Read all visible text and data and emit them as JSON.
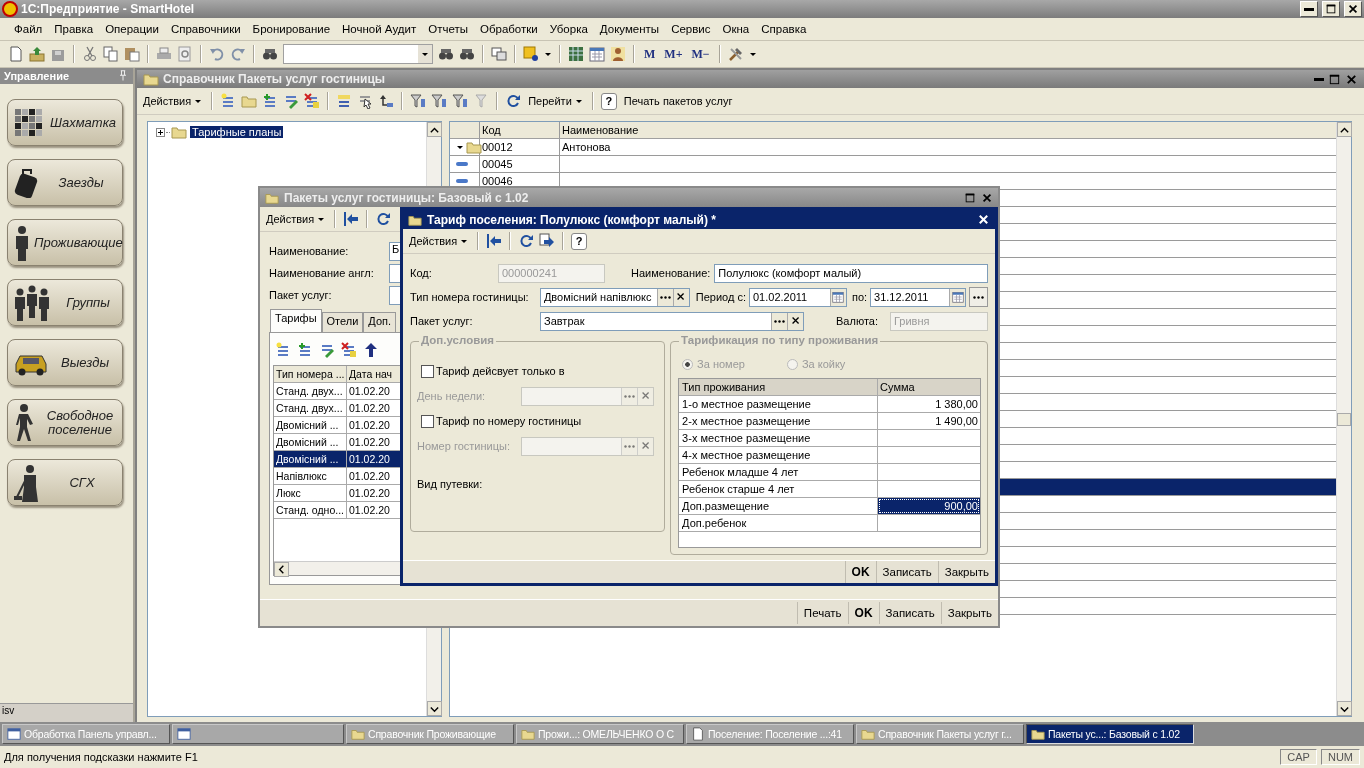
{
  "app": {
    "title": "1С:Предприятие - SmartHotel"
  },
  "menu": [
    {
      "label": "Файл"
    },
    {
      "label": "Правка"
    },
    {
      "label": "Операции"
    },
    {
      "label": "Справочники"
    },
    {
      "label": "Бронирование"
    },
    {
      "label": "Ночной Аудит"
    },
    {
      "label": "Отчеты"
    },
    {
      "label": "Обработки"
    },
    {
      "label": "Уборка"
    },
    {
      "label": "Документы"
    },
    {
      "label": "Сервис"
    },
    {
      "label": "Окна"
    },
    {
      "label": "Справка"
    }
  ],
  "toolbar": {
    "memory_buttons": [
      "M",
      "M+",
      "M−"
    ]
  },
  "sidebar": {
    "title": "Управление",
    "footer": "isv",
    "items": [
      {
        "label": "Шахматка",
        "kind": "grid"
      },
      {
        "label": "Заезды",
        "kind": "luggage"
      },
      {
        "label": "Проживающие",
        "kind": "person"
      },
      {
        "label": "Группы",
        "kind": "group"
      },
      {
        "label": "Выезды",
        "kind": "car"
      },
      {
        "label": "Свободное поселение",
        "kind": "walker"
      },
      {
        "label": "СГХ",
        "kind": "cleaner"
      }
    ]
  },
  "catalog_window": {
    "title": "Справочник Пакеты услуг гостиницы",
    "actions": "Действия",
    "goto": "Перейти",
    "help": "?",
    "print": "Печать пакетов услуг",
    "tree": [
      {
        "label": "Тарифные планы",
        "selected": true,
        "expanded": false
      }
    ],
    "columns": [
      "Код",
      "Наименование"
    ],
    "rows": [
      {
        "kind": "folder",
        "code": "00012",
        "name": "Антонова",
        "selected": false
      },
      {
        "kind": "item",
        "code": "00045",
        "selected": false
      },
      {
        "kind": "item",
        "code": "00046",
        "selected": false
      },
      {
        "selected": false
      },
      {
        "selected": false
      },
      {
        "selected": false
      },
      {
        "selected": false
      },
      {
        "selected": false
      },
      {
        "selected": false
      },
      {
        "selected": false
      },
      {
        "selected": false
      },
      {
        "selected": false
      },
      {
        "selected": false
      },
      {
        "selected": false
      },
      {
        "selected": false
      },
      {
        "selected": false
      },
      {
        "selected": false
      },
      {
        "selected": false
      },
      {
        "selected": false
      },
      {
        "selected": false
      },
      {
        "selected": true
      },
      {
        "selected": false
      },
      {
        "selected": false
      },
      {
        "selected": false
      },
      {
        "selected": false
      },
      {
        "selected": false
      },
      {
        "selected": false
      },
      {
        "selected": false
      }
    ]
  },
  "package_window": {
    "title": "Пакеты услуг гостиницы: Базовый с 1.02",
    "actions": "Действия",
    "fields": [
      {
        "label": "Наименование:",
        "value": "Б"
      },
      {
        "label": "Наименование англ:"
      },
      {
        "label": "Пакет услуг:"
      }
    ],
    "tabs": [
      {
        "label": "Тарифы",
        "selected": true
      },
      {
        "label": "Отели",
        "selected": false
      },
      {
        "label": "Доп.",
        "selected": false
      }
    ],
    "columns": [
      "Тип номера ...",
      "Дата нач"
    ],
    "rows": [
      {
        "type": "Станд. двух...",
        "date": "01.02.20",
        "selected": false
      },
      {
        "type": "Станд. двух...",
        "date": "01.02.20",
        "selected": false
      },
      {
        "type": "Двомісний ...",
        "date": "01.02.20",
        "selected": false
      },
      {
        "type": "Двомісний ...",
        "date": "01.02.20",
        "selected": false
      },
      {
        "type": "Двомісний ...",
        "date": "01.02.20",
        "selected": true
      },
      {
        "type": "Напівлюкс",
        "date": "01.02.20",
        "selected": false
      },
      {
        "type": "Люкс",
        "date": "01.02.20",
        "selected": false
      },
      {
        "type": "Станд. одно...",
        "date": "01.02.20",
        "selected": false
      }
    ],
    "buttons": [
      {
        "label": "Печать",
        "default": false
      },
      {
        "label": "OK",
        "default": true
      },
      {
        "label": "Записать",
        "default": false
      },
      {
        "label": "Закрыть",
        "default": false
      }
    ]
  },
  "tariff_window": {
    "title": "Тариф поселения: Полулюкс (комфорт малый) *",
    "actions": "Действия",
    "help": "?",
    "code": {
      "label": "Код:",
      "value": "000000241"
    },
    "name": {
      "label": "Наименование:",
      "value": "Полулюкс (комфорт малый)"
    },
    "room_type": {
      "label": "Тип номера гостиницы:",
      "value": "Двомісний напівлюкс"
    },
    "period_from": {
      "label": "Период с:",
      "value": "01.02.2011"
    },
    "period_to": {
      "label": "по:",
      "value": "31.12.2011"
    },
    "package": {
      "label": "Пакет услуг:",
      "value": "Завтрак"
    },
    "currency": {
      "label": "Валюта:",
      "value": "Гривня"
    },
    "conditions": {
      "title": "Доп.условия",
      "weekday_only": {
        "label": "Тариф дейсвует только в",
        "checked": false
      },
      "weekday": {
        "label": "День недели:"
      },
      "by_room": {
        "label": "Тариф по номеру гостиницы",
        "checked": false
      },
      "room": {
        "label": "Номер гостиницы:"
      },
      "voucher": {
        "label": "Вид путевки:"
      }
    },
    "pricing": {
      "title": "Тарификация по типу проживания",
      "modes": [
        {
          "label": "За номер",
          "selected": true
        },
        {
          "label": "За койку",
          "selected": false
        }
      ],
      "columns": [
        "Тип проживания",
        "Сумма"
      ],
      "rows": [
        {
          "type": "1-о местное размещение",
          "sum": "1 380,00",
          "selected": false
        },
        {
          "type": "2-х местное размещение",
          "sum": "1 490,00",
          "selected": false
        },
        {
          "type": "3-х местное размещение",
          "selected": false
        },
        {
          "type": "4-х местное размещение",
          "selected": false
        },
        {
          "type": "Ребенок младше 4 лет",
          "selected": false
        },
        {
          "type": "Ребенок старше 4 лет",
          "selected": false
        },
        {
          "type": "Доп.размещение",
          "sum": "900,00",
          "selected": true
        },
        {
          "type": "Доп.ребенок",
          "selected": false
        }
      ]
    },
    "buttons": [
      {
        "label": "OK",
        "default": true
      },
      {
        "label": "Записать",
        "default": false
      },
      {
        "label": "Закрыть",
        "default": false
      }
    ]
  },
  "taskbar": [
    {
      "kind": "form",
      "label": "Обработка  Панель управл...",
      "selected": false
    },
    {
      "kind": "form",
      "selected": false
    },
    {
      "kind": "folder",
      "label": "Справочник Проживающие",
      "selected": false
    },
    {
      "kind": "folder",
      "label": "Прожи...: ОМЕЛЬЧЕНКО О С",
      "selected": false
    },
    {
      "kind": "doc",
      "label": "Поселение: Поселение ...:41",
      "selected": false
    },
    {
      "kind": "folder",
      "label": "Справочник Пакеты услуг г...",
      "selected": false
    },
    {
      "kind": "folder",
      "label": "Пакеты ус...: Базовый с 1.02",
      "selected": true
    }
  ],
  "status_bar": {
    "hint": "Для получения подсказки нажмите F1",
    "indicators": [
      "CAP",
      "NUM"
    ]
  }
}
